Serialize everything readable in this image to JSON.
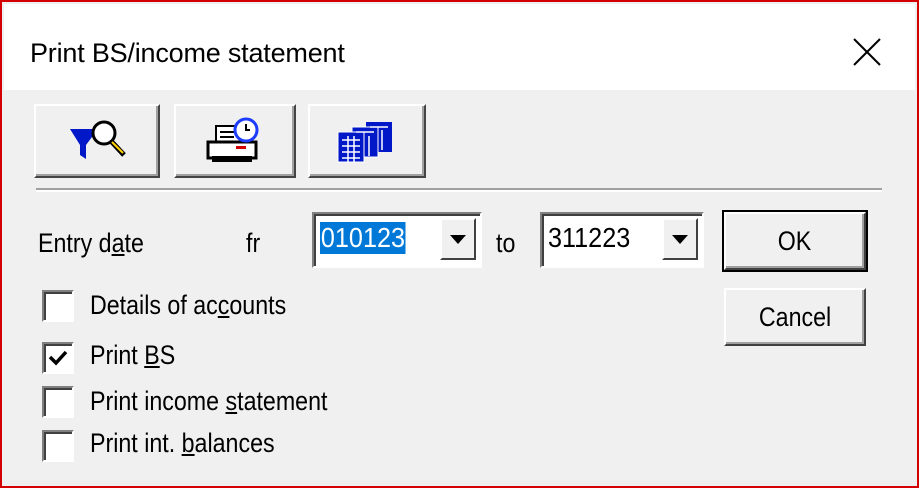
{
  "window": {
    "title": "Print BS/income statement",
    "close_icon": "close-icon"
  },
  "toolbar": {
    "buttons": [
      {
        "icon": "filter-search-icon"
      },
      {
        "icon": "print-scheduled-icon"
      },
      {
        "icon": "multi-sheets-icon"
      }
    ]
  },
  "entry_date": {
    "label_pre": "Entry d",
    "label_u": "a",
    "label_post": "te",
    "from_label": "fr",
    "from_value": "010123",
    "to_label": "to",
    "to_value": "311223"
  },
  "options": [
    {
      "pre": "Details of ac",
      "u": "c",
      "post": "ounts",
      "checked": false
    },
    {
      "pre": "Print ",
      "u": "B",
      "post": "S",
      "checked": true
    },
    {
      "pre": "Print income ",
      "u": "s",
      "post": "tatement",
      "checked": false
    },
    {
      "pre": "Print int. ",
      "u": "b",
      "post": "alances",
      "checked": false
    }
  ],
  "buttons": {
    "ok_label": "OK",
    "cancel_label": "Cancel"
  },
  "colors": {
    "selection": "#0078d7",
    "frame": "#d40000"
  }
}
